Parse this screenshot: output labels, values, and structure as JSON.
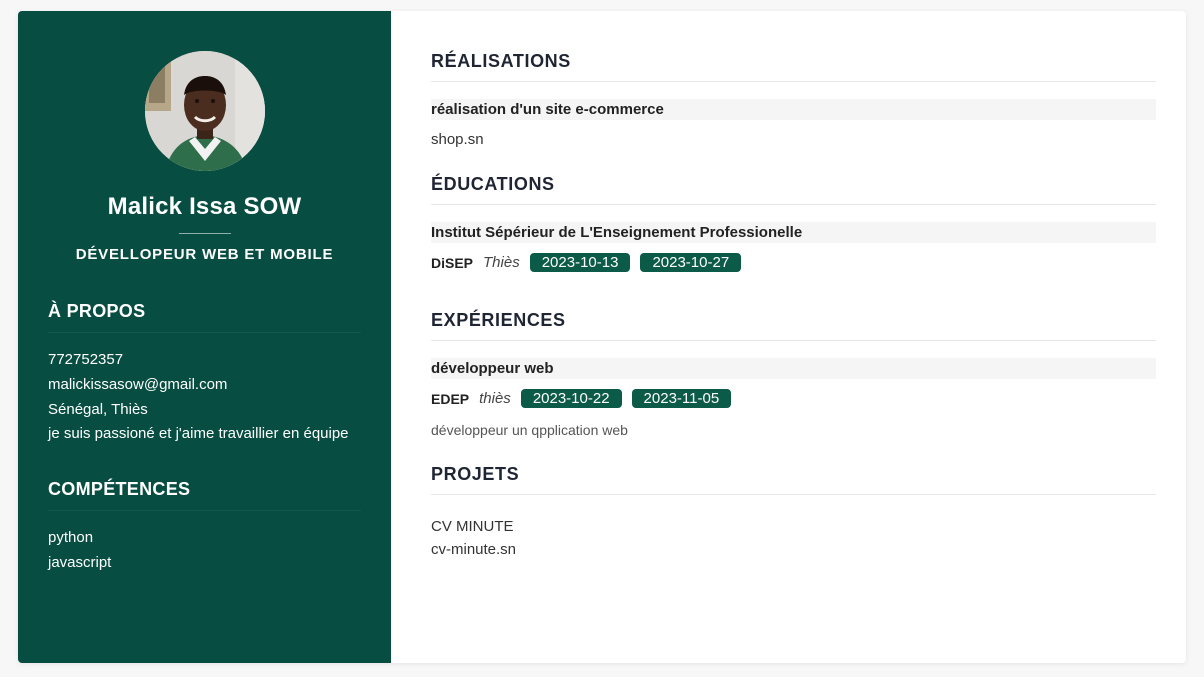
{
  "profile": {
    "name": "Malick Issa SOW",
    "role": "DÉVELLOPEUR WEB ET MOBILE"
  },
  "about": {
    "heading": "À PROPOS",
    "phone": "772752357",
    "email": "malickissasow@gmail.com",
    "location": "Sénégal, Thiès",
    "text": "je suis passioné et j'aime travaillier en équipe"
  },
  "skills": {
    "heading": "COMPÉTENCES",
    "items": [
      "python",
      "javascript"
    ]
  },
  "achievements": {
    "heading": "RÉALISATIONS",
    "title": "réalisation d'un site e-commerce",
    "detail": "shop.sn"
  },
  "education": {
    "heading": "ÉDUCATIONS",
    "title": "Institut Sépérieur de L'Enseignement Professionelle",
    "org": "DiSEP",
    "location": "Thiès",
    "start": "2023-10-13",
    "end": "2023-10-27"
  },
  "experience": {
    "heading": "EXPÉRIENCES",
    "title": "développeur web",
    "org": "EDEP",
    "location": "thiès",
    "start": "2023-10-22",
    "end": "2023-11-05",
    "description": "développeur un qpplication web"
  },
  "projects": {
    "heading": "PROJETS",
    "name": "CV MINUTE",
    "url": "cv-minute.sn"
  },
  "colors": {
    "sidebar": "#074d41",
    "pill": "#0c5a48"
  }
}
